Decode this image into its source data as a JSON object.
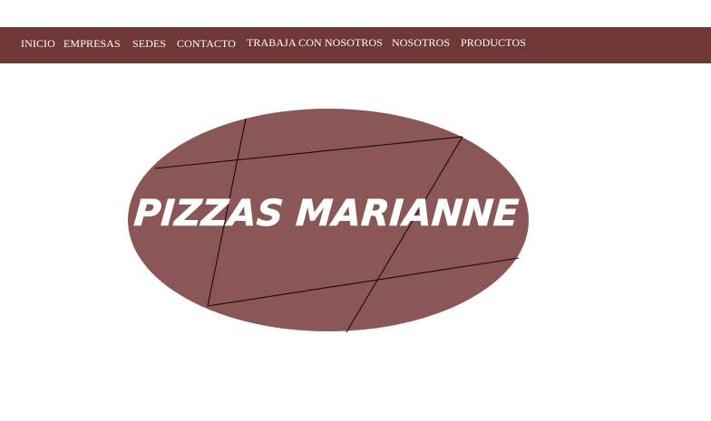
{
  "nav": {
    "items": [
      {
        "label": "INICIO"
      },
      {
        "label": "EMPRESAS"
      },
      {
        "label": "SEDES"
      },
      {
        "label": "CONTACTO"
      },
      {
        "label": "TRABAJA CON NOSOTROS"
      },
      {
        "label": "NOSOTROS"
      },
      {
        "label": "PRODUCTOS"
      }
    ]
  },
  "logo": {
    "text": "PIZZAS MARIANNE"
  },
  "colors": {
    "navbar": "#6f3836",
    "logo_fill": "#8a5756",
    "nav_text": "#ffffff"
  }
}
